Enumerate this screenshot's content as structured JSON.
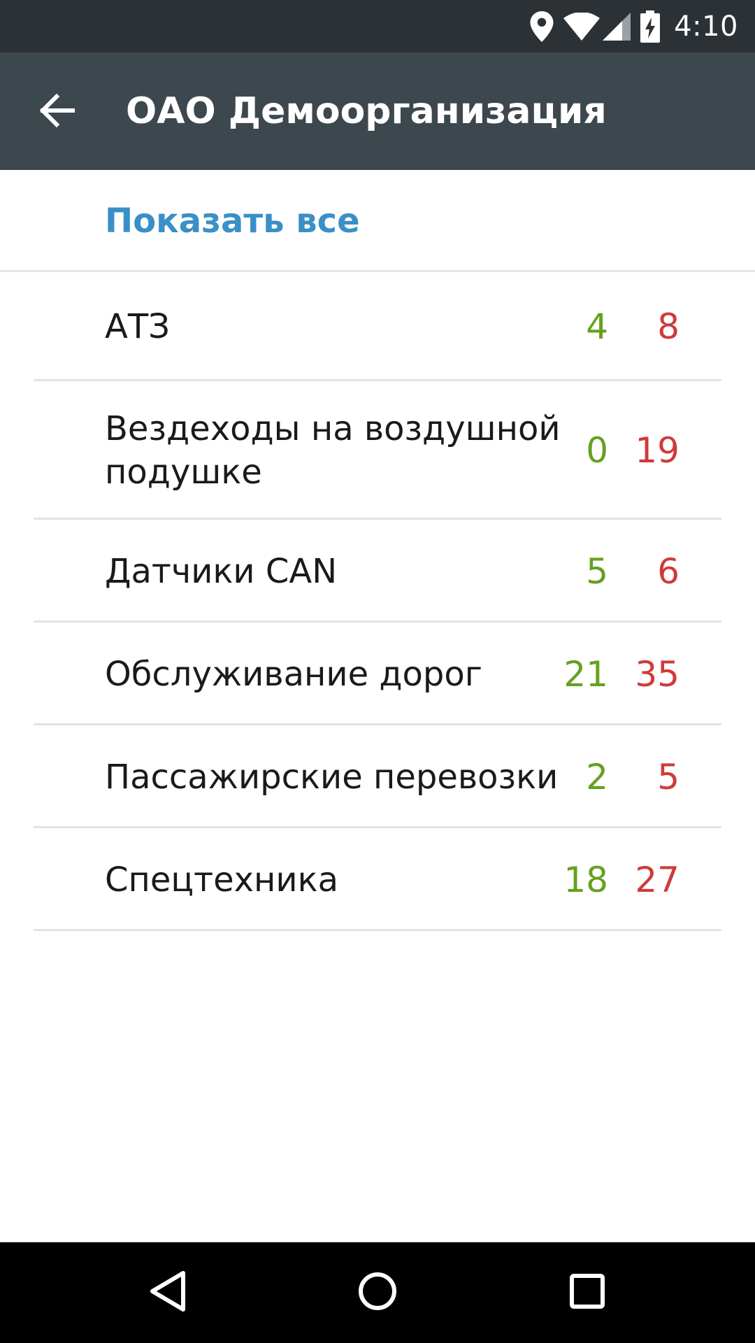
{
  "status_bar": {
    "time": "4:10",
    "icons": [
      "location-icon",
      "wifi-icon",
      "signal-icon",
      "battery-charging-icon"
    ]
  },
  "app_bar": {
    "title": "ОАО Демоорганизация",
    "back_icon": "arrow-back-icon"
  },
  "show_all": {
    "label": "Показать все"
  },
  "groups": [
    {
      "name": "АТЗ",
      "green": "4",
      "red": "8"
    },
    {
      "name": "Вездеходы на воздушной подушке",
      "green": "0",
      "red": "19"
    },
    {
      "name": "Датчики CAN",
      "green": "5",
      "red": "6"
    },
    {
      "name": "Обслуживание дорог",
      "green": "21",
      "red": "35"
    },
    {
      "name": "Пассажирские перевозки",
      "green": "2",
      "red": "5"
    },
    {
      "name": "Спецтехника",
      "green": "18",
      "red": "27"
    }
  ],
  "colors": {
    "status_bar": "#2b3135",
    "app_bar": "#3d474e",
    "accent": "#3a8fc7",
    "green": "#65a020",
    "red": "#d03a3a"
  },
  "nav_bar": {
    "icons": [
      "back-triangle-icon",
      "home-circle-icon",
      "recents-square-icon"
    ]
  }
}
